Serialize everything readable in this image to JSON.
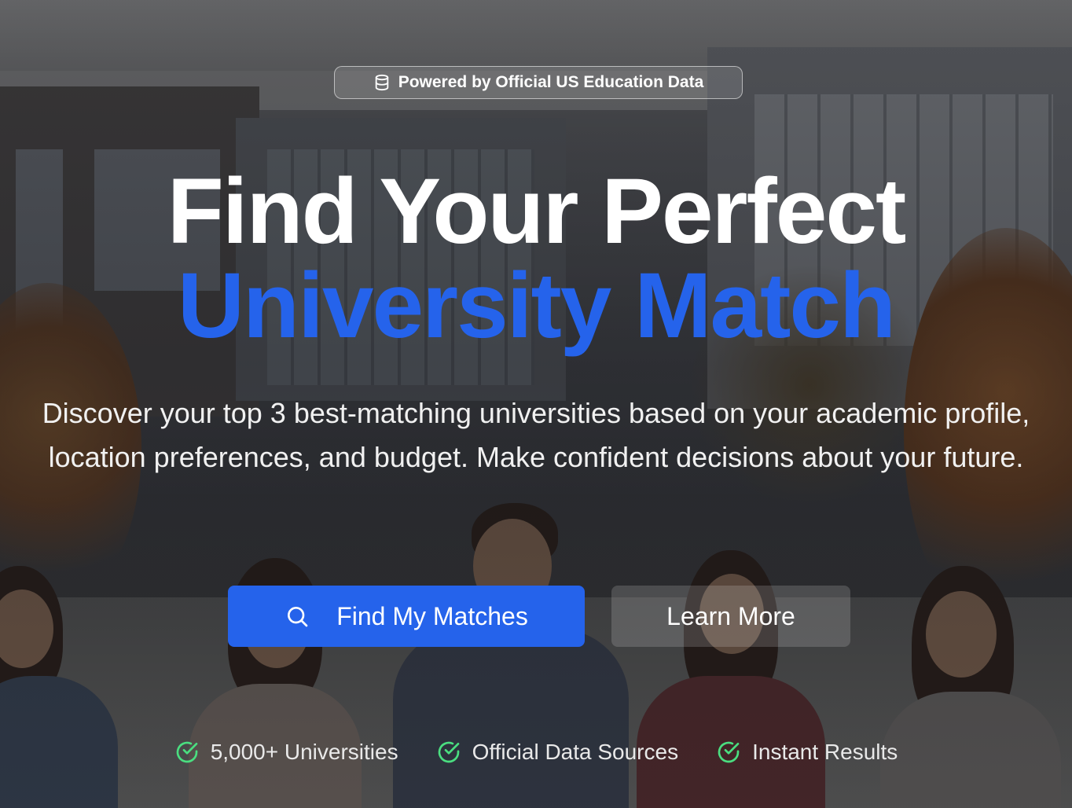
{
  "badge": {
    "icon": "database-icon",
    "label": "Powered by Official US Education Data"
  },
  "hero": {
    "title_line1": "Find Your Perfect",
    "title_line2": "University Match",
    "subtitle": "Discover your top 3 best-matching universities based on your academic profile, location preferences, and budget. Make confident decisions about your future.",
    "accent_color": "#2563eb"
  },
  "actions": {
    "primary": {
      "icon": "search-icon",
      "label": "Find My Matches"
    },
    "secondary": {
      "label": "Learn More"
    }
  },
  "features": [
    {
      "icon": "check-circle-icon",
      "label": "5,000+ Universities"
    },
    {
      "icon": "check-circle-icon",
      "label": "Official Data Sources"
    },
    {
      "icon": "check-circle-icon",
      "label": "Instant Results"
    }
  ],
  "colors": {
    "check": "#4ade80",
    "text": "#ffffff"
  }
}
